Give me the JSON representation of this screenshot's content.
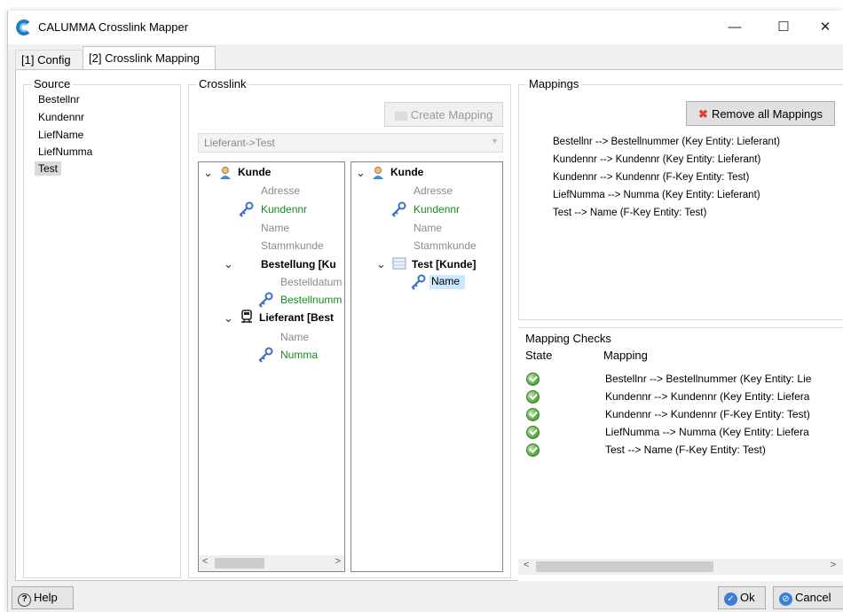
{
  "window": {
    "title": "CALUMMA Crosslink Mapper",
    "controls": {
      "minimize": "—",
      "maximize": "☐",
      "close": "✕"
    }
  },
  "tabs": [
    {
      "label": "[1] Config",
      "active": false
    },
    {
      "label": "[2] Crosslink Mapping",
      "active": true
    }
  ],
  "source": {
    "title": "Source",
    "items": [
      "Bestellnr",
      "Kundennr",
      "LiefName",
      "LiefNumma",
      "Test"
    ],
    "selected": "Test"
  },
  "crosslink": {
    "title": "Crosslink",
    "create_button": "Create Mapping",
    "combo_value": "Lieferant->Test",
    "left_tree": {
      "kunde": "Kunde",
      "adresse": "Adresse",
      "kundennr": "Kundennr",
      "name": "Name",
      "stammkunde": "Stammkunde",
      "bestellung": "Bestellung [Ku",
      "bestelldatum": "Bestelldatum",
      "bestellnummer": "Bestellnumm",
      "lieferant": "Lieferant [Best",
      "lief_name": "Name",
      "numma": "Numma"
    },
    "right_tree": {
      "kunde": "Kunde",
      "adresse": "Adresse",
      "kundennr": "Kundennr",
      "name": "Name",
      "stammkunde": "Stammkunde",
      "test": "Test [Kunde]",
      "test_name": "Name"
    }
  },
  "mappings": {
    "title": "Mappings",
    "remove_button": "Remove all Mappings",
    "lines": [
      "Bestellnr --> Bestellnummer (Key Entity: Lieferant)",
      "Kundennr --> Kundennr (Key Entity: Lieferant)",
      "Kundennr --> Kundennr (F-Key Entity: Test)",
      "LiefNumma --> Numma (Key Entity: Lieferant)",
      "Test --> Name (F-Key Entity: Test)"
    ]
  },
  "mapping_checks": {
    "title": "Mapping Checks",
    "columns": {
      "state": "State",
      "mapping": "Mapping"
    },
    "rows": [
      "Bestellnr --> Bestellnummer (Key Entity: Lie",
      "Kundennr --> Kundennr (Key Entity: Liefera",
      "Kundennr --> Kundennr (F-Key Entity: Test)",
      "LiefNumma --> Numma (Key Entity: Liefera",
      "Test --> Name (F-Key Entity: Test)"
    ]
  },
  "footer": {
    "help": "Help",
    "ok": "Ok",
    "cancel": "Cancel"
  },
  "colors": {
    "mapped_green": "#1a8a1a",
    "selection_blue": "#cce8ff",
    "remove_red": "#e0403a"
  }
}
